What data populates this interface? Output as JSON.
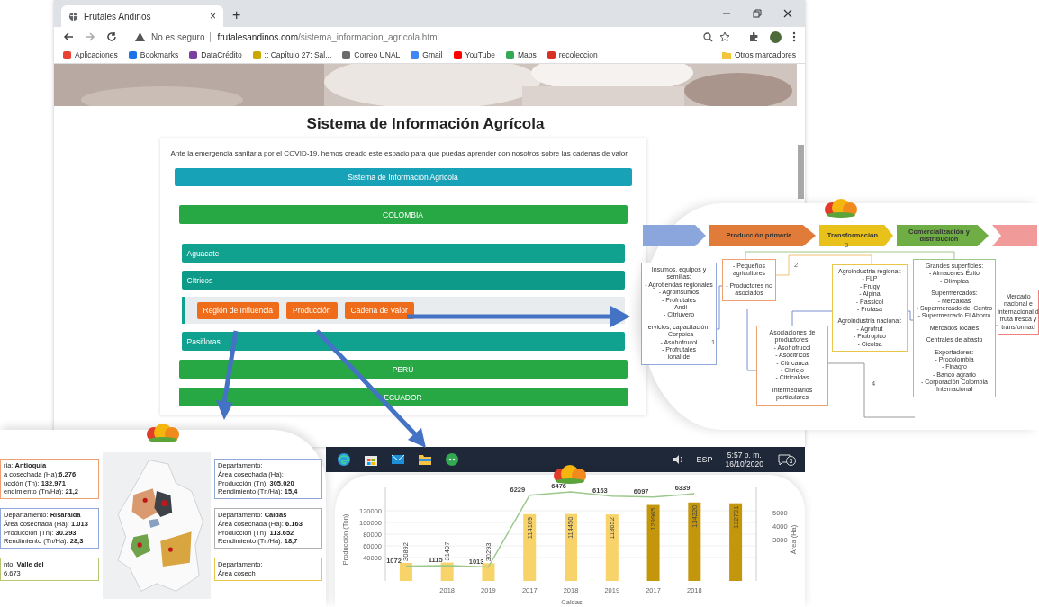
{
  "browser": {
    "tab_title": "Frutales Andinos",
    "tab_close": "×",
    "new_tab": "+",
    "security": "No es seguro",
    "url_host": "frutalesandinos.com",
    "url_path": "/sistema_informacion_agricola.html",
    "bookmarks": [
      {
        "label": "Aplicaciones",
        "color": "#e94235"
      },
      {
        "label": "Bookmarks",
        "color": "#1a73e8"
      },
      {
        "label": "DataCrédito",
        "color": "#7b3fa0"
      },
      {
        "label": ":: Capítulo 27: Sal...",
        "color": "#c9a800"
      },
      {
        "label": "Correo UNAL",
        "color": "#6b6b6b"
      },
      {
        "label": "Gmail",
        "color": "#4285f4"
      },
      {
        "label": "YouTube",
        "color": "#ff0000"
      },
      {
        "label": "Maps",
        "color": "#34a853"
      },
      {
        "label": "recoleccion",
        "color": "#d93025"
      }
    ],
    "other_bookmarks": "Otros marcadores"
  },
  "page": {
    "title": "Sistema de Información Agrícola",
    "intro": "Ante la emergencia sanitaria por el COVID-19, hemos creado este espacio para que puedas aprender con nosotros sobre las cadenas de valor.",
    "banner": "Sistema de Información Agrícola",
    "countries": [
      {
        "label": "COLOMBIA",
        "expanded": true,
        "fruits": [
          {
            "label": "Aguacate",
            "expanded": false
          },
          {
            "label": "Cítricos",
            "expanded": true,
            "actions": [
              "Región de Influencia",
              "Producción",
              "Cadena de Valor"
            ]
          },
          {
            "label": "Pasifloras",
            "expanded": false
          }
        ]
      },
      {
        "label": "PERÚ",
        "expanded": false
      },
      {
        "label": "ECUADOR",
        "expanded": false
      }
    ]
  },
  "taskbar": {
    "language": "ESP",
    "time": "5:57 p. m.",
    "date": "16/10/2020",
    "notifications": "3"
  },
  "value_chain": {
    "stages": [
      {
        "label": "Producción primaria",
        "color": "#e07b39"
      },
      {
        "label": "Transformación",
        "color": "#e8c21a"
      },
      {
        "label": "Comercialización y distribución",
        "color": "#6fae45"
      }
    ],
    "boxes": [
      {
        "color": "#8fa8d8",
        "groups": [
          [
            "Insumos, equipos y",
            "semillas:",
            "- Agrotiendas regionales",
            "- Agroinsumos",
            "- Profrutales",
            "- Andi",
            "- Citriuvero"
          ],
          [
            "ervicios, capacitación:",
            "- Corpoica",
            "- Asohofrucol",
            "- Profrutales",
            "ional de"
          ]
        ]
      },
      {
        "color": "#f0a070",
        "groups": [
          [
            "- Pequeños",
            "agricultores"
          ],
          [
            "- Productores no",
            "asociados"
          ]
        ]
      },
      {
        "color": "#f0a070",
        "groups": [
          [
            "Asociaciones de",
            "productores:",
            "- Asohofrucol",
            "- Asocitricos",
            "- Citricauca",
            "- Citriejo",
            "- Citricaldas"
          ],
          [
            "Intermediarios",
            "particulares"
          ]
        ]
      },
      {
        "color": "#e8c64a",
        "groups": [
          [
            "Agroindustria regional:",
            "- FLP",
            "- Frugy",
            "- Alpina",
            "- Passicol",
            "- Frutasa"
          ],
          [
            "Agroindustria nacional:",
            "- Agrofrut",
            "- Frutropico",
            "- Cicolsa"
          ]
        ]
      },
      {
        "color": "#9cc88a",
        "groups": [
          [
            "Grandes superficies:",
            "- Almacenes Éxito",
            "- Olímpica"
          ],
          [
            "Supermercados:",
            "- Mercaldas",
            "- Supermercado del Centro",
            "- Supermercado El Ahorro"
          ],
          [
            "Mercados locales"
          ],
          [
            "Centrales de abasto"
          ],
          [
            "Exportadores:",
            "- Procolombia",
            "- Finagro",
            "- Banco agrario",
            "- Corporación Colombia",
            "Internacional"
          ]
        ]
      },
      {
        "color": "#f08080",
        "groups": [
          [
            "Mercado",
            "nacional e",
            "internacional d",
            "fruta fresca y",
            "transformad"
          ]
        ]
      }
    ],
    "flow_numbers": [
      "1",
      "2",
      "3",
      "4"
    ]
  },
  "region_map": {
    "left_cards": [
      {
        "color": "#f0a070",
        "lines": [
          "ria: **Antioquia**",
          "a cosechada (Ha):**6.276**",
          "ucción (Tn): **132.971**",
          "endimiento (Tn/Ha): **21,2**"
        ]
      },
      {
        "color": "#8fa8d8",
        "lines": [
          "Departamento: **Risaralda**",
          "Área cosechada (Ha): **1.013**",
          "Producción (Tn): **30.293**",
          "Rendimiento (Tn/Ha): **28,3**"
        ]
      },
      {
        "color": "#b8c870",
        "lines": [
          "nto: **Valle del**",
          "6.673"
        ]
      }
    ],
    "right_cards": [
      {
        "color": "#8fa8d8",
        "lines": [
          "Departamento:",
          "Área cosechada (Ha):",
          "Producción (Tn): **305.020**",
          "Rendimiento (Tn/Ha): **15,4**"
        ]
      },
      {
        "color": "#b0b0b0",
        "lines": [
          "Departamento: **Caldas**",
          "Área cosechada (Ha): **6.163**",
          "Producción (Tn): **113.652**",
          "Rendimiento (Tn/Ha): **18,7**"
        ]
      },
      {
        "color": "#e8c64a",
        "lines": [
          "Departamento:",
          "Área cosech"
        ]
      }
    ]
  },
  "production_chart": {
    "chart_data": {
      "type": "bar",
      "xlabel": "Caldas",
      "ylabel": "Producción (Ton)",
      "y2label": "Área (Ha)",
      "categories": [
        null,
        "2018",
        "2019",
        "2017",
        "2018",
        "2019",
        "2017",
        "2018",
        null
      ],
      "series": [
        {
          "color": "#f8d36a",
          "values": [
            30892,
            31497,
            30293,
            114109,
            114450,
            113652,
            null,
            null,
            null
          ]
        },
        {
          "color": "#c4960c",
          "values": [
            null,
            null,
            null,
            null,
            null,
            null,
            129965,
            134220,
            132791
          ]
        },
        {
          "color": "#9cc88c",
          "type": "line",
          "axis": "y2",
          "values": [
            1072,
            1115,
            1013,
            6229,
            6476,
            6163,
            6097,
            6339,
            null
          ]
        }
      ],
      "ylim": [
        0,
        160000
      ],
      "yticks": [
        40000,
        60000,
        80000,
        100000,
        120000
      ],
      "y2lim": [
        0,
        6800
      ],
      "y2ticks": [
        3000,
        4000,
        5000
      ],
      "grid": true,
      "data_labels": true
    }
  }
}
